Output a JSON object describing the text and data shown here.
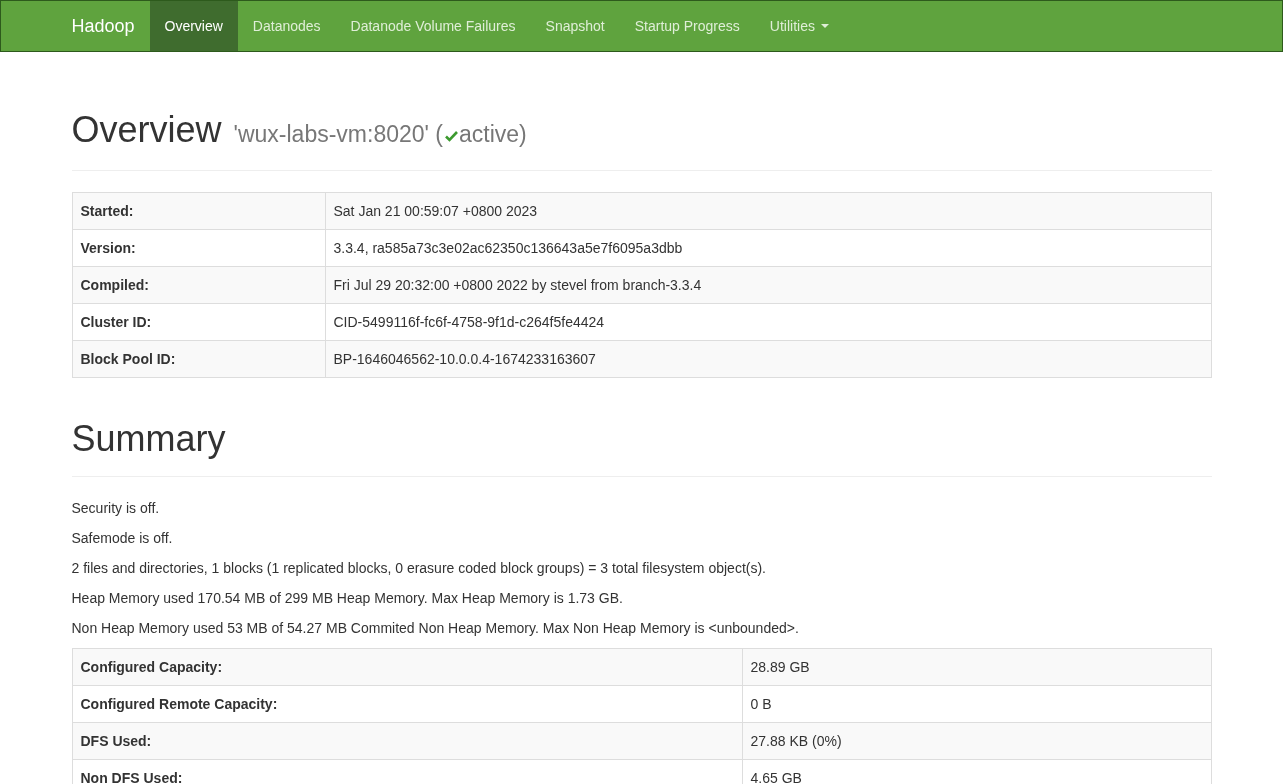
{
  "navbar": {
    "brand": "Hadoop",
    "items": [
      {
        "label": "Overview",
        "selected": true,
        "dropdown": false
      },
      {
        "label": "Datanodes",
        "selected": false,
        "dropdown": false
      },
      {
        "label": "Datanode Volume Failures",
        "selected": false,
        "dropdown": false
      },
      {
        "label": "Snapshot",
        "selected": false,
        "dropdown": false
      },
      {
        "label": "Startup Progress",
        "selected": false,
        "dropdown": false
      },
      {
        "label": "Utilities",
        "selected": false,
        "dropdown": true
      }
    ]
  },
  "overview": {
    "title": "Overview",
    "host": "'wux-labs-vm:8020' (",
    "state": "active)",
    "rows": [
      {
        "label": "Started:",
        "value": "Sat Jan 21 00:59:07 +0800 2023"
      },
      {
        "label": "Version:",
        "value": "3.3.4, ra585a73c3e02ac62350c136643a5e7f6095a3dbb"
      },
      {
        "label": "Compiled:",
        "value": "Fri Jul 29 20:32:00 +0800 2022 by stevel from branch-3.3.4"
      },
      {
        "label": "Cluster ID:",
        "value": "CID-5499116f-fc6f-4758-9f1d-c264f5fe4424"
      },
      {
        "label": "Block Pool ID:",
        "value": "BP-1646046562-10.0.0.4-1674233163607"
      }
    ]
  },
  "summary": {
    "title": "Summary",
    "lines": [
      "Security is off.",
      "Safemode is off.",
      "2 files and directories, 1 blocks (1 replicated blocks, 0 erasure coded block groups) = 3 total filesystem object(s).",
      "Heap Memory used 170.54 MB of 299 MB Heap Memory. Max Heap Memory is 1.73 GB.",
      "Non Heap Memory used 53 MB of 54.27 MB Commited Non Heap Memory. Max Non Heap Memory is <unbounded>."
    ],
    "rows": [
      {
        "label": "Configured Capacity:",
        "value": "28.89 GB"
      },
      {
        "label": "Configured Remote Capacity:",
        "value": "0 B"
      },
      {
        "label": "DFS Used:",
        "value": "27.88 KB (0%)"
      },
      {
        "label": "Non DFS Used:",
        "value": "4.65 GB"
      }
    ]
  }
}
